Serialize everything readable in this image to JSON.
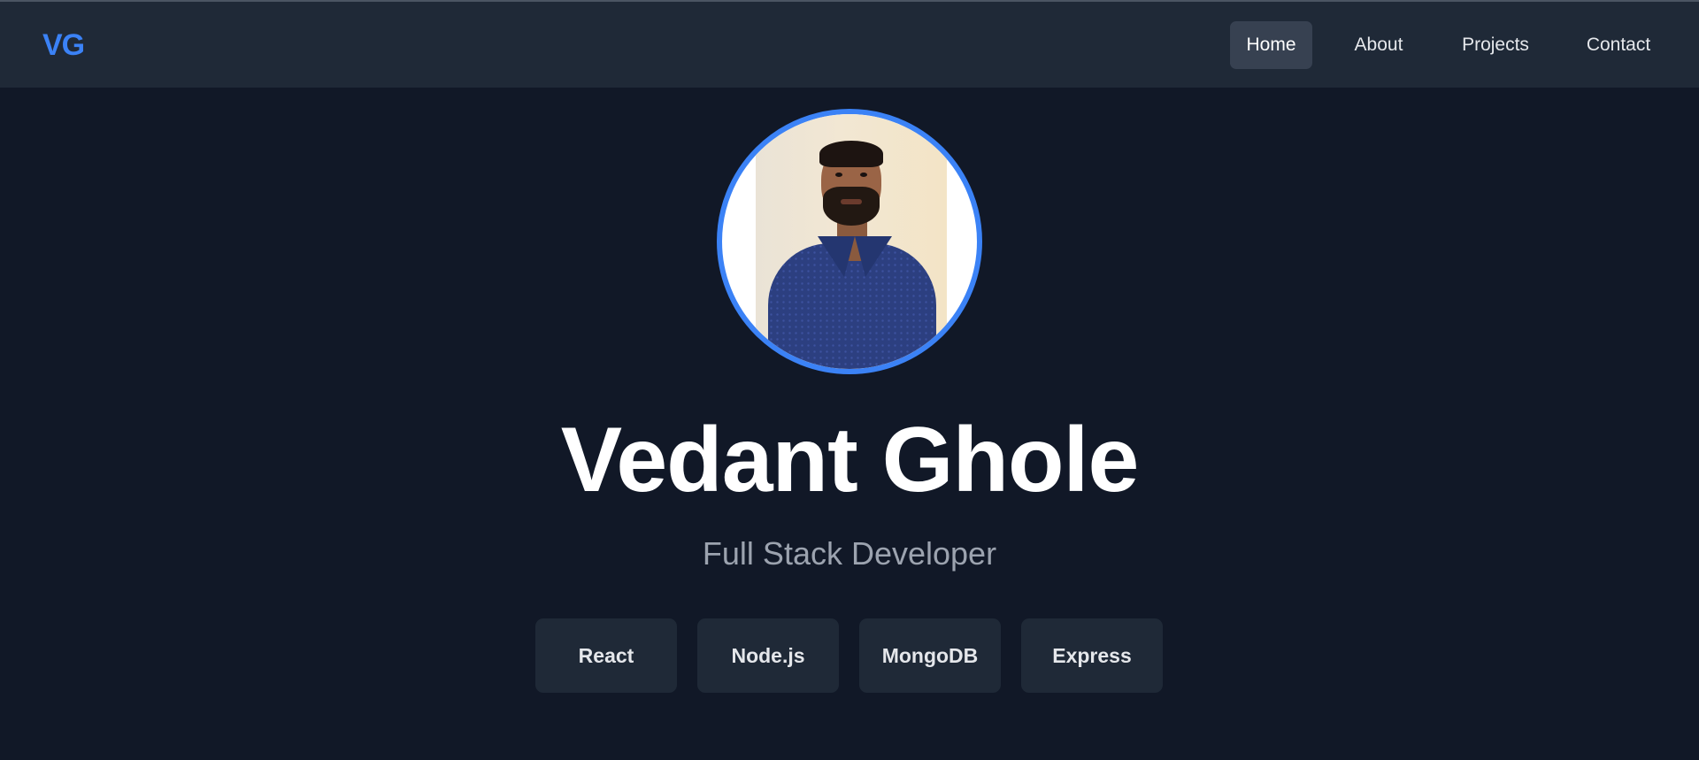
{
  "navbar": {
    "logo": "VG",
    "links": [
      {
        "label": "Home",
        "active": true
      },
      {
        "label": "About",
        "active": false
      },
      {
        "label": "Projects",
        "active": false
      },
      {
        "label": "Contact",
        "active": false
      }
    ]
  },
  "hero": {
    "name": "Vedant Ghole",
    "role": "Full Stack Developer",
    "skills": [
      "React",
      "Node.js",
      "MongoDB",
      "Express"
    ]
  },
  "colors": {
    "background": "#111827",
    "navbar": "#1f2937",
    "accent": "#3b82f6",
    "active_link_bg": "#374151",
    "tag_bg": "#1f2937",
    "muted_text": "#9ca3af"
  }
}
